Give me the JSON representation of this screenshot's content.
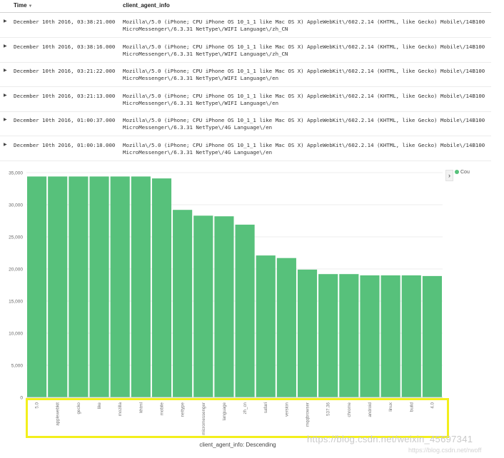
{
  "table": {
    "columns": {
      "time": "Time",
      "client_agent_info": "client_agent_info"
    },
    "rows": [
      {
        "time": "December 10th 2016, 03:38:21.000",
        "info_line1": "Mozilla\\/5.0 (iPhone; CPU iPhone OS 10_1_1 like Mac OS X) AppleWebKit\\/602.2.14 (KHTML, like Gecko) Mobile\\/14B100",
        "info_line2": "MicroMessenger\\/6.3.31 NetType\\/WIFI Language\\/zh_CN"
      },
      {
        "time": "December 10th 2016, 03:38:16.000",
        "info_line1": "Mozilla\\/5.0 (iPhone; CPU iPhone OS 10_1_1 like Mac OS X) AppleWebKit\\/602.2.14 (KHTML, like Gecko) Mobile\\/14B100",
        "info_line2": "MicroMessenger\\/6.3.31 NetType\\/WIFI Language\\/zh_CN"
      },
      {
        "time": "December 10th 2016, 03:21:22.000",
        "info_line1": "Mozilla\\/5.0 (iPhone; CPU iPhone OS 10_1_1 like Mac OS X) AppleWebKit\\/602.2.14 (KHTML, like Gecko) Mobile\\/14B100",
        "info_line2": "MicroMessenger\\/6.3.31 NetType\\/WIFI Language\\/en"
      },
      {
        "time": "December 10th 2016, 03:21:13.000",
        "info_line1": "Mozilla\\/5.0 (iPhone; CPU iPhone OS 10_1_1 like Mac OS X) AppleWebKit\\/602.2.14 (KHTML, like Gecko) Mobile\\/14B100",
        "info_line2": "MicroMessenger\\/6.3.31 NetType\\/WIFI Language\\/en"
      },
      {
        "time": "December 10th 2016, 01:00:37.000",
        "info_line1": "Mozilla\\/5.0 (iPhone; CPU iPhone OS 10_1_1 like Mac OS X) AppleWebKit\\/602.2.14 (KHTML, like Gecko) Mobile\\/14B100",
        "info_line2": "MicroMessenger\\/6.3.31 NetType\\/4G Language\\/en"
      },
      {
        "time": "December 10th 2016, 01:00:18.000",
        "info_line1": "Mozilla\\/5.0 (iPhone; CPU iPhone OS 10_1_1 like Mac OS X) AppleWebKit\\/602.2.14 (KHTML, like Gecko) Mobile\\/14B100",
        "info_line2": "MicroMessenger\\/6.3.31 NetType\\/4G Language\\/en"
      }
    ]
  },
  "icons": {
    "sort": "sort-down-icon",
    "expand": "expand-caret-icon",
    "legend_toggle": "chevron-right-icon"
  },
  "legend": {
    "label": "Cou"
  },
  "chart_data": {
    "type": "bar",
    "categories": [
      "5.0",
      "applewebkit",
      "gecko",
      "like",
      "mozilla",
      "khtml",
      "mobile",
      "nettype",
      "micromessenger",
      "language",
      "zh_cn",
      "safari",
      "version",
      "mqqbrowser",
      "537.36",
      "chrome",
      "android",
      "linux",
      "build",
      "4.0"
    ],
    "values": [
      34400,
      34400,
      34400,
      34400,
      34400,
      34400,
      34100,
      29200,
      28300,
      28200,
      26900,
      22100,
      21700,
      19900,
      19200,
      19200,
      19000,
      19000,
      19000,
      18900
    ],
    "xlabel": "client_agent_info: Descending",
    "ylim": [
      0,
      35000
    ],
    "yticks": [
      0,
      5000,
      10000,
      15000,
      20000,
      25000,
      30000,
      35000
    ],
    "ytick_labels": [
      "0",
      "5,000",
      "10,000",
      "15,000",
      "20,000",
      "25,000",
      "30,000",
      "35,000"
    ],
    "bar_color": "#57c17b",
    "grid": true
  },
  "watermark": {
    "text": "https://blog.csdn.net/weixin_45697341",
    "text2": "https://blog.csdn.net/rwoff"
  },
  "highlight_color": "#f3ef1c"
}
